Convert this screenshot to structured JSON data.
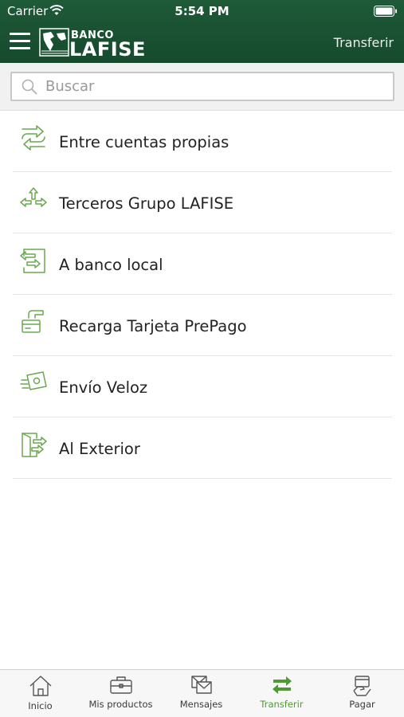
{
  "status": {
    "carrier": "Carrier",
    "time": "5:54 PM"
  },
  "header": {
    "logo_top": "BANCO",
    "logo_main": "LAFISE",
    "title": "Transferir"
  },
  "search": {
    "placeholder": "Buscar",
    "value": ""
  },
  "menu": [
    {
      "label": "Entre cuentas propias",
      "icon": "arrows-exchange-icon"
    },
    {
      "label": "Terceros Grupo LAFISE",
      "icon": "split-arrows-icon"
    },
    {
      "label": "A banco local",
      "icon": "door-arrows-icon"
    },
    {
      "label": "Recarga Tarjeta PrePago",
      "icon": "card-recharge-icon"
    },
    {
      "label": "Envío Veloz",
      "icon": "fast-money-icon"
    },
    {
      "label": "Al Exterior",
      "icon": "door-exit-icon"
    }
  ],
  "tabs": [
    {
      "label": "Inicio",
      "icon": "home-icon",
      "active": false
    },
    {
      "label": "Mis productos",
      "icon": "briefcase-icon",
      "active": false
    },
    {
      "label": "Mensajes",
      "icon": "envelope-icon",
      "active": false
    },
    {
      "label": "Transferir",
      "icon": "transfer-icon",
      "active": true
    },
    {
      "label": "Pagar",
      "icon": "pay-icon",
      "active": false
    }
  ],
  "colors": {
    "header_bg": "#1e5a38",
    "accent": "#6aa84f",
    "active_tab": "#4f9a32"
  }
}
